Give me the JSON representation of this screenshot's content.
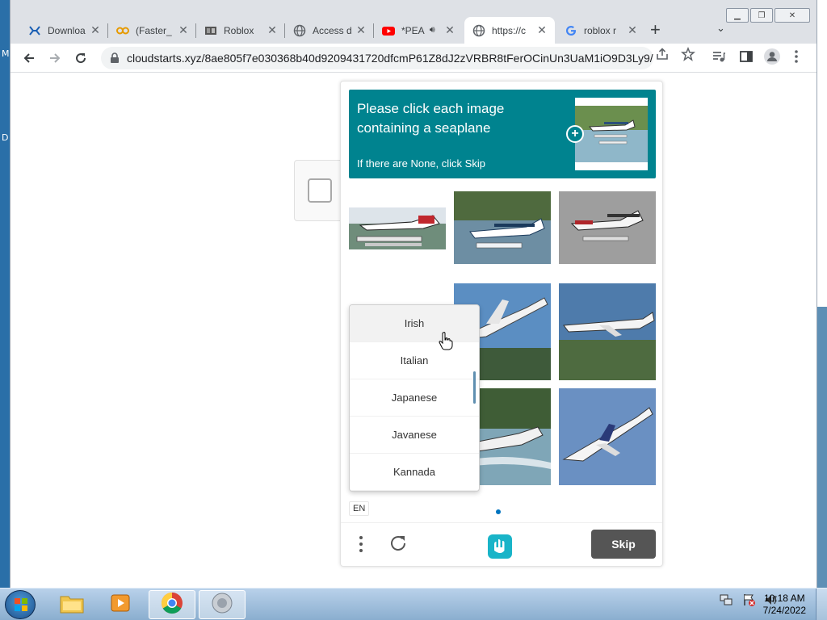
{
  "desktop": {
    "letters": [
      "M",
      "D"
    ]
  },
  "browser": {
    "tabs": [
      {
        "title": "Downloa",
        "icon": "malwarebytes-icon"
      },
      {
        "title": "(Faster_",
        "icon": "glasses-icon"
      },
      {
        "title": "Roblox",
        "icon": "film-icon"
      },
      {
        "title": "Access d",
        "icon": "globe-icon"
      },
      {
        "title": "*PEA",
        "icon": "youtube-icon"
      },
      {
        "title": "https://c",
        "icon": "globe-icon"
      },
      {
        "title": "roblox r",
        "icon": "google-icon"
      }
    ],
    "active_tab_index": 5,
    "url": "cloudstarts.xyz/8ae805f7e030368b40d9209431720dfcmP61Z8dJ2zVRBR8tFerOCinUn3UaM1iO9D3Ly9/i"
  },
  "captcha": {
    "prompt_line1": "Please click each image",
    "prompt_line2": "containing a seaplane",
    "prompt_sub": "If there are None, click Skip",
    "language_options": [
      "Irish",
      "Italian",
      "Japanese",
      "Javanese",
      "Kannada"
    ],
    "hovered_option": "Irish",
    "language_code": "EN",
    "skip_label": "Skip",
    "accent_color": "#00838f"
  },
  "taskbar": {
    "time": "10:18 AM",
    "date": "7/24/2022"
  }
}
